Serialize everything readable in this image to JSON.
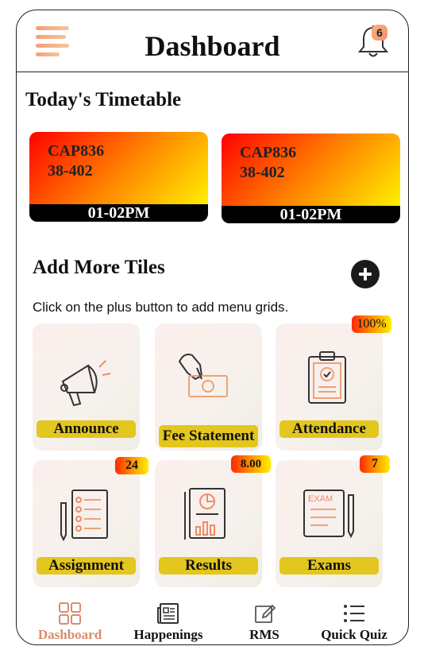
{
  "header": {
    "title": "Dashboard",
    "notification_count": "6"
  },
  "timetable": {
    "title": "Today's Timetable",
    "cards": [
      {
        "code": "CAP836",
        "room": "38-402",
        "time": "01-02PM"
      },
      {
        "code": "CAP836",
        "room": "38-402",
        "time": "01-02PM"
      }
    ]
  },
  "tiles_section": {
    "title": "Add More Tiles",
    "hint": "Click on the plus button to add menu grids."
  },
  "tiles": [
    {
      "label": "Announce",
      "badge": ""
    },
    {
      "label": "Fee Statement",
      "badge": ""
    },
    {
      "label": "Attendance",
      "badge": "100%"
    },
    {
      "label": "Assignment",
      "badge": "24"
    },
    {
      "label": "Results",
      "badge": "8.00"
    },
    {
      "label": "Exams",
      "badge": "7"
    }
  ],
  "bottom_nav": [
    {
      "label": "Dashboard",
      "active": true
    },
    {
      "label": "Happenings",
      "active": false
    },
    {
      "label": "RMS",
      "active": false
    },
    {
      "label": "Quick Quiz",
      "active": false
    }
  ],
  "colors": {
    "accent": "#d98b6f",
    "tile_label_bg": "#e3c61e",
    "header_text": "#111111"
  }
}
